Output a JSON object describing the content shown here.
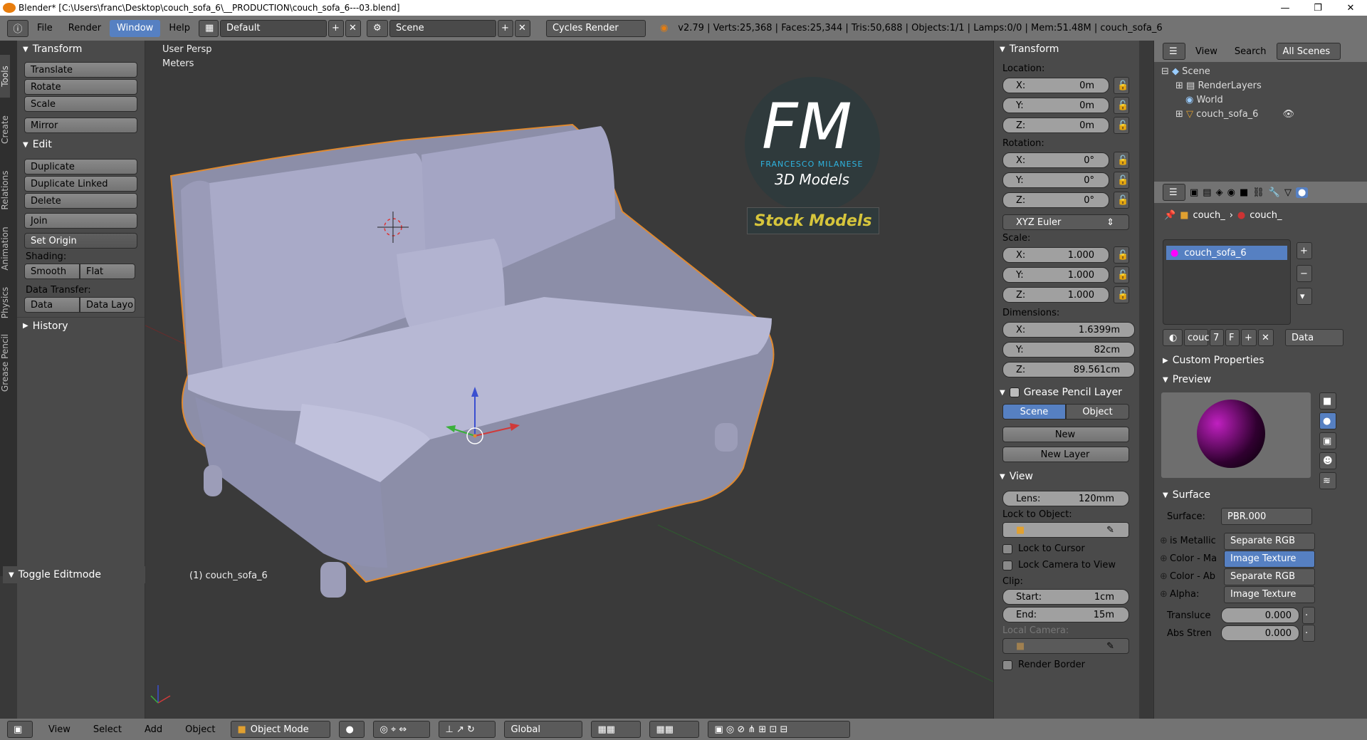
{
  "window": {
    "title": "Blender* [C:\\Users\\franc\\Desktop\\couch_sofa_6\\__PRODUCTION\\couch_sofa_6---03.blend]"
  },
  "menu": {
    "file": "File",
    "render": "Render",
    "window": "Window",
    "help": "Help"
  },
  "header": {
    "layout": "Default",
    "scene": "Scene",
    "engine": "Cycles Render",
    "stats": "v2.79 | Verts:25,368 | Faces:25,344 | Tris:50,688 | Objects:1/1 | Lamps:0/0 | Mem:51.48M | couch_sofa_6"
  },
  "tooltabs": [
    "Tools",
    "Create",
    "Relations",
    "Animation",
    "Physics",
    "Grease Pencil"
  ],
  "tools": {
    "transform_title": "Transform",
    "translate": "Translate",
    "rotate": "Rotate",
    "scale": "Scale",
    "mirror": "Mirror",
    "edit_title": "Edit",
    "duplicate": "Duplicate",
    "duplicate_linked": "Duplicate Linked",
    "delete": "Delete",
    "join": "Join",
    "set_origin": "Set Origin",
    "shading_label": "Shading:",
    "smooth": "Smooth",
    "flat": "Flat",
    "data_transfer_label": "Data Transfer:",
    "data": "Data",
    "data_layo": "Data Layo",
    "history": "History",
    "toggle_editmode": "Toggle Editmode"
  },
  "viewport": {
    "persp": "User Persp",
    "units": "Meters",
    "object_label": "(1) couch_sofa_6",
    "logo": {
      "letters": "FM",
      "name": "FRANCESCO MILANESE",
      "sub": "3D Models",
      "stock": "Stock Models"
    }
  },
  "npanel": {
    "transform_title": "Transform",
    "location_label": "Location:",
    "loc": [
      {
        "a": "X:",
        "v": "0m"
      },
      {
        "a": "Y:",
        "v": "0m"
      },
      {
        "a": "Z:",
        "v": "0m"
      }
    ],
    "rotation_label": "Rotation:",
    "rot": [
      {
        "a": "X:",
        "v": "0°"
      },
      {
        "a": "Y:",
        "v": "0°"
      },
      {
        "a": "Z:",
        "v": "0°"
      }
    ],
    "rot_mode": "XYZ Euler",
    "scale_label": "Scale:",
    "scl": [
      {
        "a": "X:",
        "v": "1.000"
      },
      {
        "a": "Y:",
        "v": "1.000"
      },
      {
        "a": "Z:",
        "v": "1.000"
      }
    ],
    "dimensions_label": "Dimensions:",
    "dim": [
      {
        "a": "X:",
        "v": "1.6399m"
      },
      {
        "a": "Y:",
        "v": "82cm"
      },
      {
        "a": "Z:",
        "v": "89.561cm"
      }
    ],
    "gp_title": "Grease Pencil Layer",
    "gp_scene": "Scene",
    "gp_object": "Object",
    "gp_new": "New",
    "gp_new_layer": "New Layer",
    "view_title": "View",
    "lens_label": "Lens:",
    "lens_value": "120mm",
    "lock_object": "Lock to Object:",
    "lock_cursor": "Lock to Cursor",
    "lock_camera": "Lock Camera to View",
    "clip_label": "Clip:",
    "clip_start_label": "Start:",
    "clip_start": "1cm",
    "clip_end_label": "End:",
    "clip_end": "15m",
    "local_camera": "Local Camera:",
    "render_border": "Render Border"
  },
  "outliner": {
    "view": "View",
    "search": "Search",
    "all_scenes": "All Scenes",
    "scene": "Scene",
    "renderlayers": "RenderLayers",
    "world": "World",
    "object": "couch_sofa_6"
  },
  "properties": {
    "crumb1": "couch_",
    "crumb2": "couch_",
    "material_slot": "couch_sofa_6",
    "mat_name": "couc",
    "users": "7",
    "fake": "F",
    "link": "Data",
    "custom_props": "Custom Properties",
    "preview": "Preview",
    "surface_title": "Surface",
    "surface_label": "Surface:",
    "surface_value": "PBR.000",
    "inputs": [
      {
        "label": "is Metallic",
        "value": "Separate RGB",
        "hl": false
      },
      {
        "label": "Color - Ma",
        "value": "Image Texture",
        "hl": true
      },
      {
        "label": "Color - Ab",
        "value": "Separate RGB",
        "hl": false
      },
      {
        "label": "Alpha:",
        "value": "Image Texture",
        "hl": false
      }
    ],
    "translucent_label": "Transluce",
    "translucent_value": "0.000",
    "abs_label": "Abs Stren",
    "abs_value": "0.000"
  },
  "bottom": {
    "view": "View",
    "select": "Select",
    "add": "Add",
    "object": "Object",
    "mode": "Object Mode",
    "orientation": "Global"
  }
}
